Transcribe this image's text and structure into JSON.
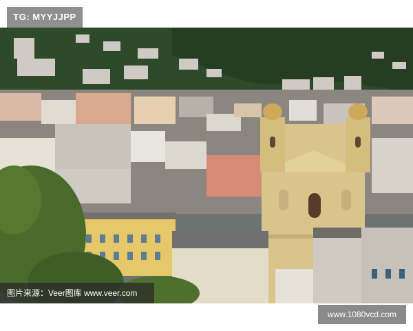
{
  "tag": {
    "text": "TG: MYYJJPP"
  },
  "caption": {
    "text": "图片来源：Veer图库 www.veer.com"
  },
  "watermark": {
    "text": "www.1080vcd.com"
  },
  "colors": {
    "hill": "#2f4a2a",
    "church": "#d9c58c",
    "roof": "#6f6c68",
    "sky_band": "#8e969a"
  }
}
